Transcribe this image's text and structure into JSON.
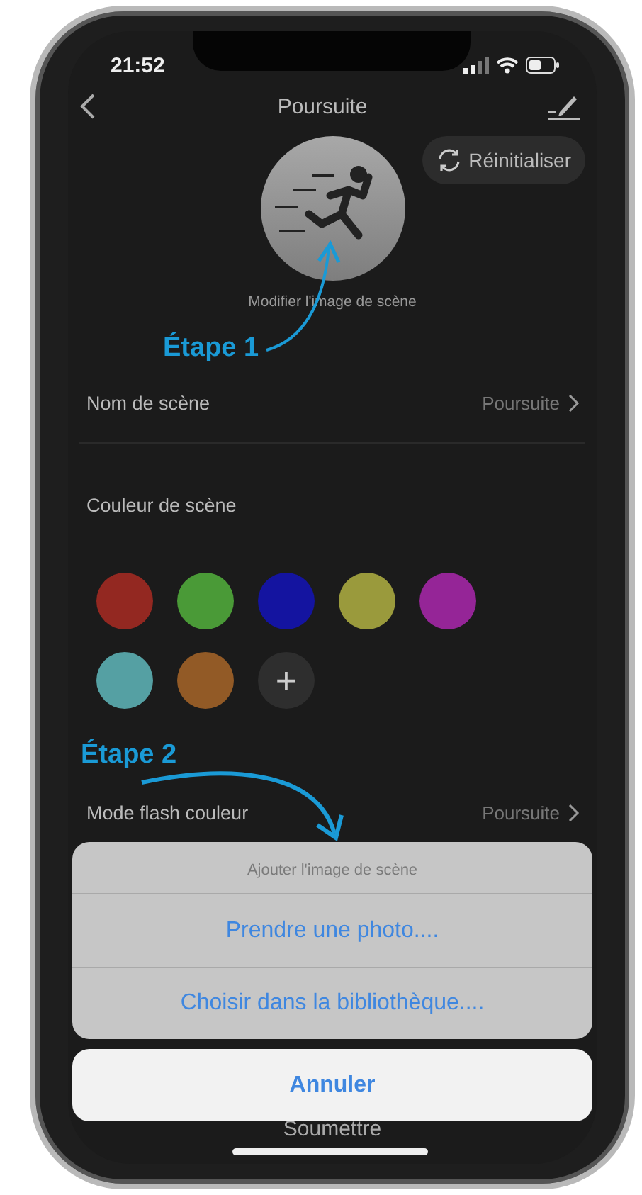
{
  "status_bar": {
    "time": "21:52"
  },
  "nav": {
    "title": "Poursuite"
  },
  "reset_button": {
    "label": "Réinitialiser"
  },
  "scene_image": {
    "caption": "Modifier l'image de scène"
  },
  "name_row": {
    "label": "Nom de scène",
    "value": "Poursuite"
  },
  "color_section": {
    "title": "Couleur de scène",
    "colors": [
      {
        "color": "#932821"
      },
      {
        "color": "#4a9a37"
      },
      {
        "color": "#1414a0"
      },
      {
        "color": "#9a9a3c"
      },
      {
        "color": "#952597"
      },
      {
        "color": "#55a0a3"
      },
      {
        "color": "#925a26"
      }
    ],
    "add_label": "+"
  },
  "flash_row": {
    "label": "Mode flash couleur",
    "value": "Poursuite"
  },
  "submit_button": {
    "label": "Soumettre"
  },
  "action_sheet": {
    "title": "Ajouter l'image de scène",
    "actions": [
      "Prendre une photo....",
      "Choisir dans la bibliothèque...."
    ],
    "cancel": "Annuler"
  },
  "annotations": [
    {
      "label": "Étape 1"
    },
    {
      "label": "Étape 2"
    }
  ]
}
